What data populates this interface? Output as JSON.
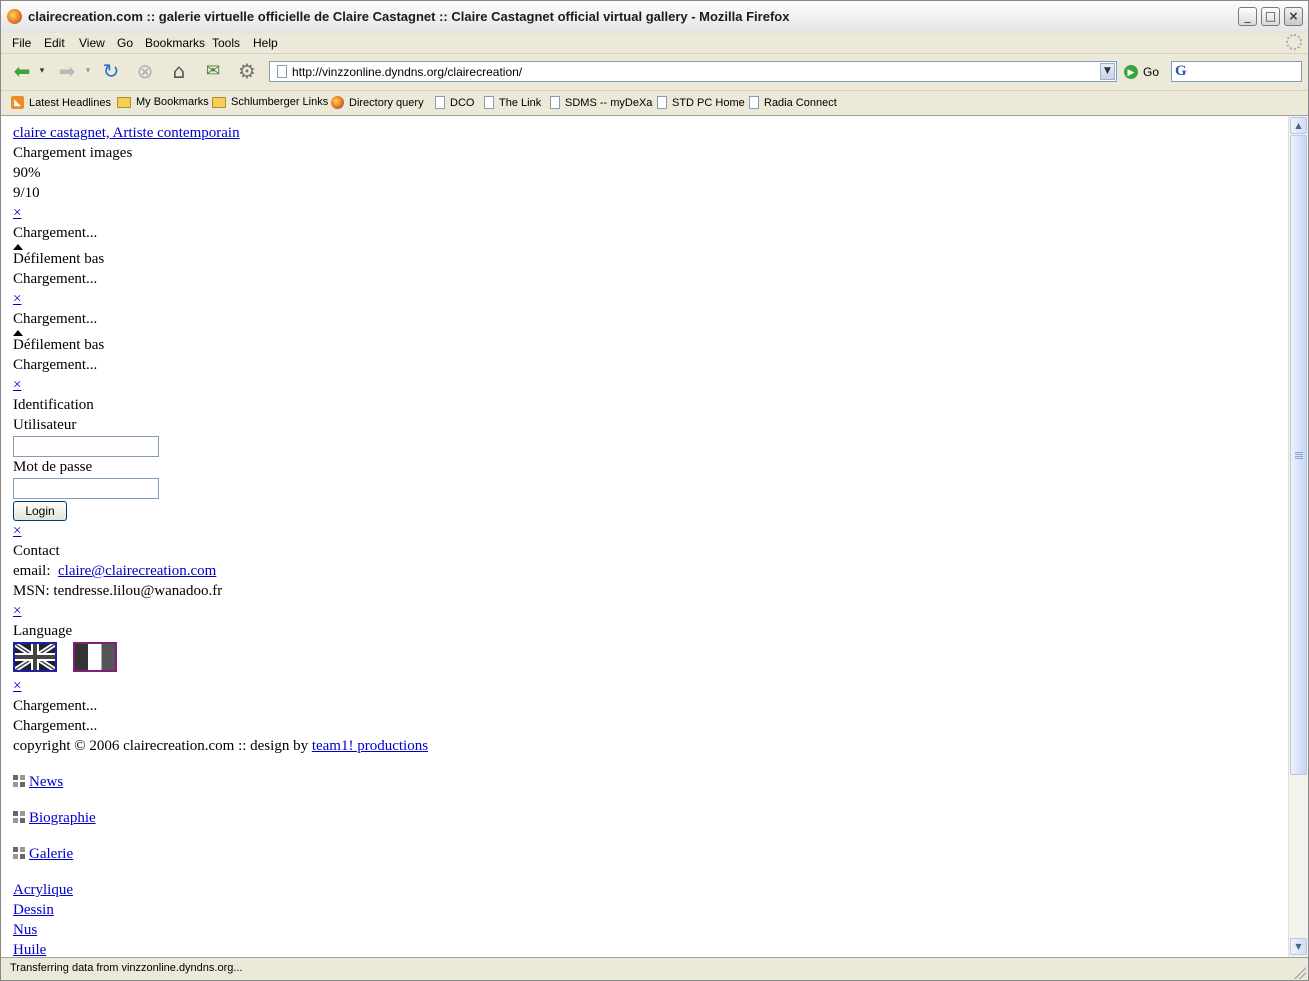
{
  "window": {
    "title": "clairecreation.com :: galerie virtuelle officielle de Claire Castagnet :: Claire Castagnet official virtual gallery - Mozilla Firefox",
    "minimize": "_",
    "maximize": "□",
    "close": "×"
  },
  "menubar": {
    "items": [
      "File",
      "Edit",
      "View",
      "Go",
      "Bookmarks",
      "Tools",
      "Help"
    ]
  },
  "navbar": {
    "url": "http://vinzzonline.dyndns.org/clairecreation/",
    "go_label": "Go",
    "search_logo": "G"
  },
  "bookmarks": [
    {
      "label": "Latest Headlines",
      "icon": "rss-icon"
    },
    {
      "label": "My Bookmarks",
      "icon": "folder-icon"
    },
    {
      "label": "Schlumberger Links",
      "icon": "folder-icon"
    },
    {
      "label": "Directory query",
      "icon": "globe-icon"
    },
    {
      "label": "DCO",
      "icon": "page-icon"
    },
    {
      "label": "The Link",
      "icon": "page-icon"
    },
    {
      "label": "SDMS -- myDeXa",
      "icon": "page-icon"
    },
    {
      "label": "STD PC Home",
      "icon": "page-icon"
    },
    {
      "label": "Radia Connect",
      "icon": "page-icon"
    }
  ],
  "page": {
    "site_link": "claire castagnet, Artiste contemporain",
    "loading_images": "Chargement images",
    "progress_percent": "90%",
    "progress_count": "9/10",
    "close_x": "×",
    "loading": "Chargement...",
    "scroll_down": "Défilement bas",
    "identification": "Identification",
    "user_label": "Utilisateur",
    "password_label": "Mot de passe",
    "login_button": "Login",
    "contact_title": "Contact",
    "email_label": "email:",
    "email_link": "claire@clairecreation.com",
    "msn_text": "MSN: tendresse.lilou@wanadoo.fr",
    "language_title": "Language",
    "copyright_text": "copyright © 2006 clairecreation.com :: design by",
    "design_link": "team1! productions",
    "nav": [
      "News",
      "Biographie",
      "Galerie"
    ],
    "sub_nav": [
      "Acrylique",
      "Dessin",
      "Nus",
      "Huile"
    ]
  },
  "statusbar": {
    "text": "Transferring data from vinzzonline.dyndns.org..."
  }
}
